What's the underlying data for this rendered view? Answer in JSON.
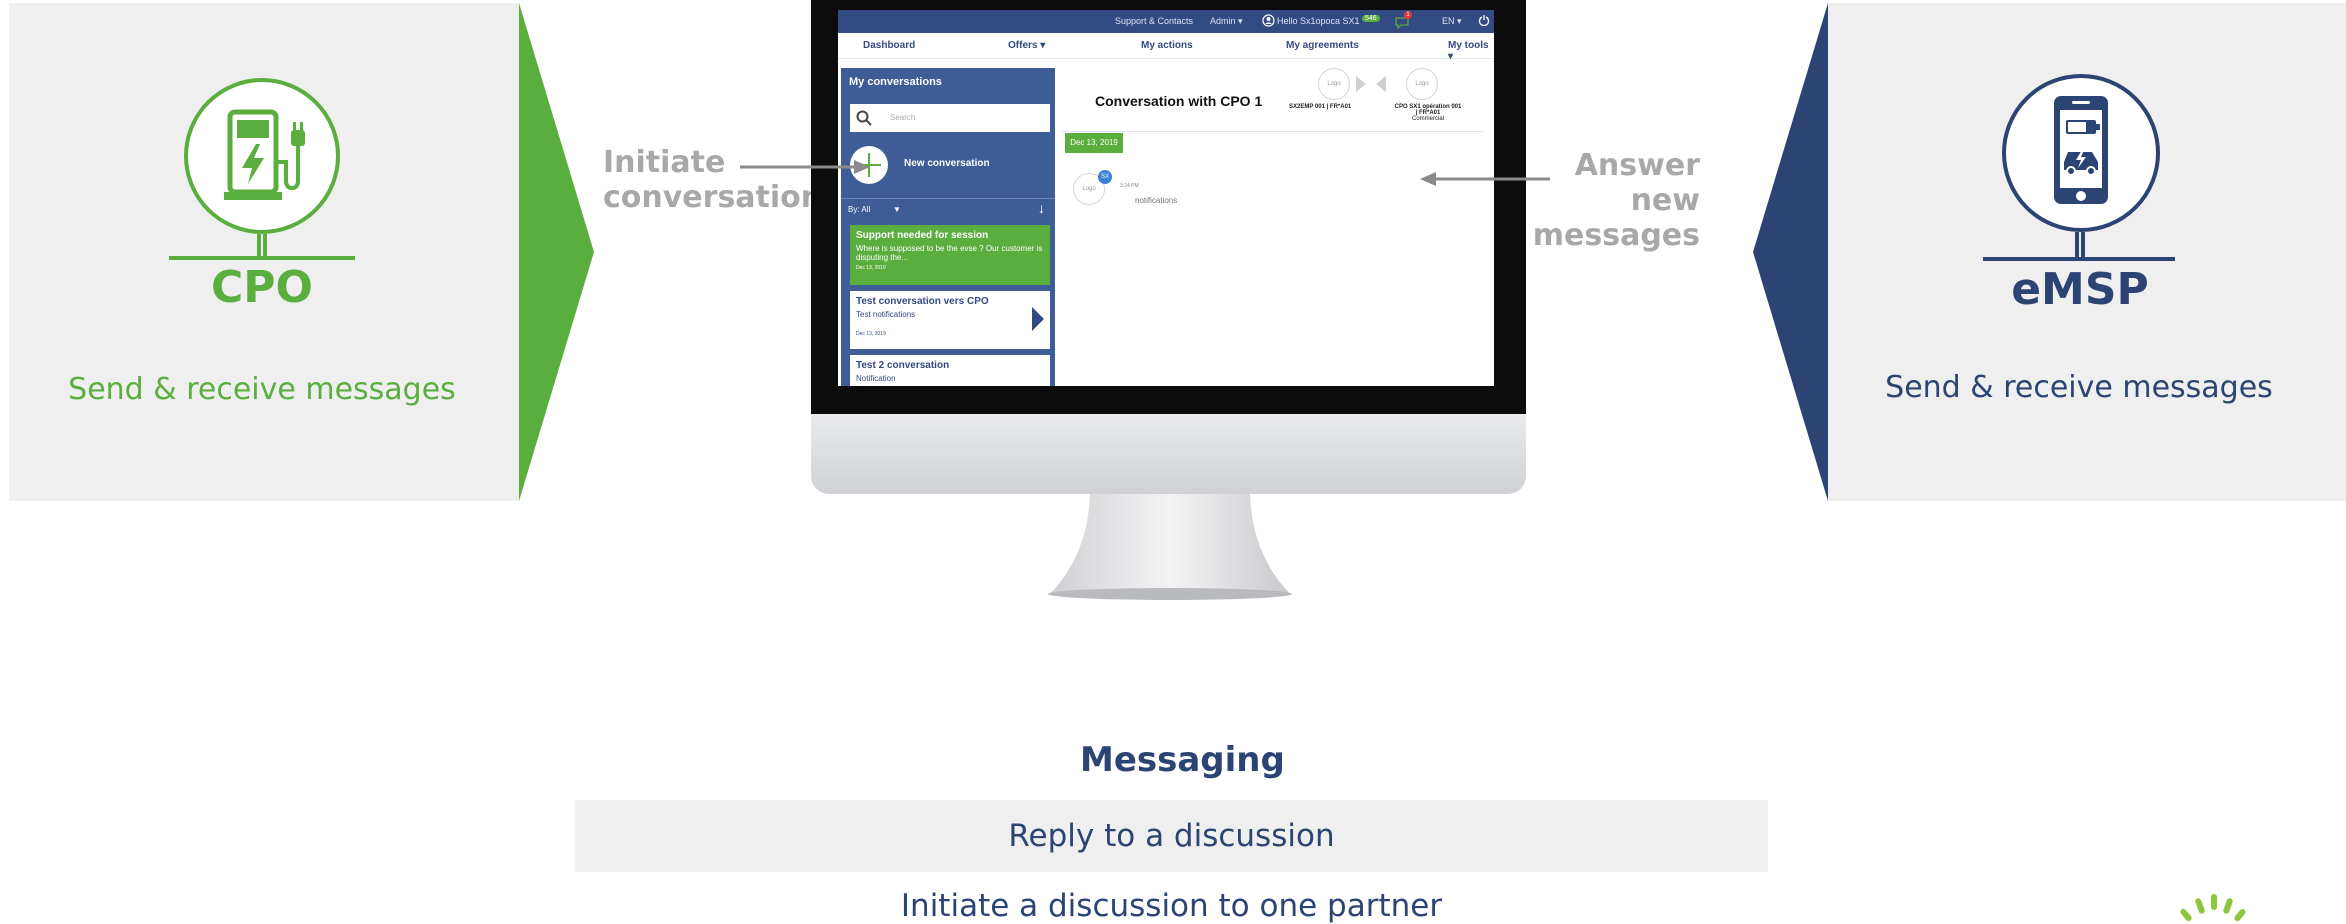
{
  "colors": {
    "cpo_green": "#5aae3e",
    "emsp_blue": "#2c4474",
    "panel_gray": "#efefef",
    "annotation_gray": "#a8a8a8"
  },
  "cpo": {
    "label": "CPO",
    "subtitle": "Send & receive messages",
    "icon": "charging-station-icon"
  },
  "emsp": {
    "label": "eMSP",
    "subtitle": "Send & receive messages",
    "icon": "smartphone-ev-icon"
  },
  "annotations": {
    "initiate": [
      "Initiate",
      "conversation"
    ],
    "answer": [
      "Answer",
      "new",
      "messages"
    ]
  },
  "app": {
    "topbar": {
      "support": "Support & Contacts",
      "admin": "Admin ▾",
      "hello": "Hello Sx1opoca SX1",
      "badge": "546",
      "notif_count": "1",
      "lang": "EN ▾"
    },
    "nav": [
      "Dashboard",
      "Offers ▾",
      "My actions",
      "My agreements",
      "My tools ▾"
    ],
    "sidebar": {
      "title": "My conversations",
      "search_placeholder": "Search",
      "new_conversation": "New conversation",
      "filter": "By: All",
      "filter_arrow": "▼",
      "conversations": [
        {
          "title": "Support needed for session",
          "subtitle": "Where is supposed to be the evse ? Our customer is disputing the...",
          "date": "Dec 13, 2019"
        },
        {
          "title": "Test conversation vers CPO",
          "subtitle": "Test notifications",
          "date": "Dec 13, 2019"
        },
        {
          "title": "Test 2 conversation",
          "subtitle": "Notification"
        }
      ]
    },
    "main": {
      "title": "Conversation with CPO 1",
      "participant_left_logo": "Logo",
      "participant_left": "SX2EMP 001 | FR*A01",
      "participant_right_logo": "Logo",
      "participant_right": [
        "CPO SX1 opération 001",
        "| FR*A01"
      ],
      "participant_right_role": "Commercial",
      "date_chip": "Dec 13, 2019",
      "message_logo": "Logo",
      "message_avatar": "SX",
      "message_time": "3:24 PM",
      "message_text": "notifications"
    }
  },
  "features": {
    "title": "Messaging",
    "items": [
      "Reply to a discussion",
      "Initiate a discussion to one partner"
    ]
  }
}
